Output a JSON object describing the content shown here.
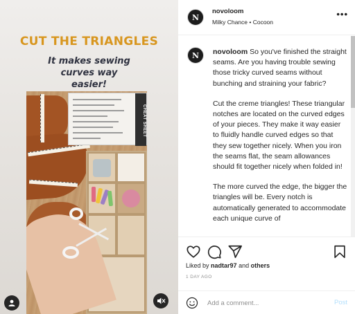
{
  "media": {
    "title": "CUT THE TRIANGLES",
    "subtitle": "It makes sewing curves way easier!",
    "cheat_sheet_label": "CHEAT SHEET",
    "title_color": "#d8961f",
    "icons": {
      "profile": "user-icon",
      "mute": "muted-speaker-icon"
    }
  },
  "post": {
    "username": "novoloom",
    "song": "Milky Chance • Cocoon",
    "logo_letter": "N",
    "more_icon": "more-horizontal-icon"
  },
  "caption": {
    "username": "novoloom",
    "first_paragraph": "So you've finished the straight seams. Are you having trouble sewing those tricky curved seams without bunching and straining your fabric?",
    "paragraphs": [
      "Cut the creme triangles! These triangular notches are located on the curved edges of your pieces. They make it way easier to fluidly handle curved edges so that they sew together nicely. When you iron the seams flat, the seam allowances should fit together nicely when folded in!",
      "The more curved the edge, the bigger the triangles will be. Every notch is automatically generated to accommodate each unique curve of"
    ]
  },
  "actions": {
    "icons": [
      "heart-icon",
      "comment-icon",
      "share-icon",
      "bookmark-icon"
    ],
    "liked_by_prefix": "Liked by",
    "liked_by_user": "nadtar97",
    "and_label": "and",
    "others_label": "others",
    "date": "1 DAY AGO"
  },
  "comment": {
    "placeholder": "Add a comment...",
    "post_label": "Post",
    "post_color": "#b2dffc"
  }
}
